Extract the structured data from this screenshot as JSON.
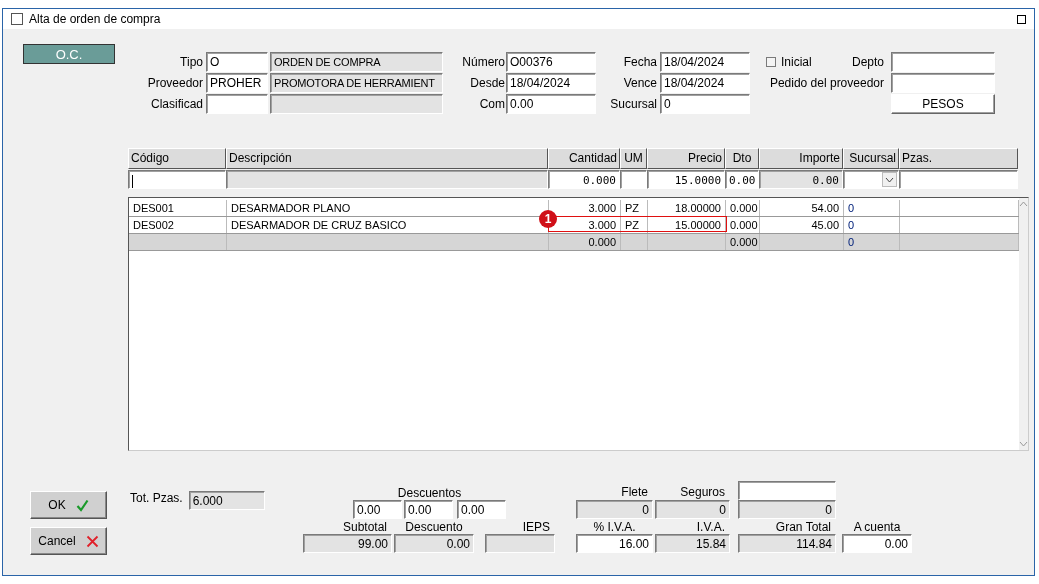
{
  "window": {
    "title": "Alta de orden de compra"
  },
  "oc_button": "O.C.",
  "header_rows": [
    {
      "label": "Tipo",
      "code": "O",
      "name": "ORDEN DE COMPRA",
      "mid_label": "Número",
      "mid_value": "O00376",
      "right_label": "Fecha",
      "right_value": "18/04/2024"
    },
    {
      "label": "Proveedor",
      "code": "PROHER",
      "name": "PROMOTORA DE HERRAMIENT",
      "mid_label": "Desde",
      "mid_value": "18/04/2024",
      "right_label": "Vence",
      "right_value": "18/04/2024"
    },
    {
      "label": "Clasificad",
      "mid_label": "Com",
      "mid_value": "0.00",
      "right_label": "Sucursal",
      "right_value": "0"
    }
  ],
  "inicial": {
    "label": "Inicial",
    "checked": false
  },
  "depto_label": "Depto",
  "pedido_label": "Pedido del proveedor",
  "currency_button": "PESOS",
  "table": {
    "columns": [
      "Código",
      "Descripción",
      "Cantidad",
      "UM",
      "Precio",
      "Dto",
      "Importe",
      "Sucursal",
      "Pzas."
    ],
    "edit_row": [
      {
        "kind": "text"
      },
      {
        "kind": "readonly"
      },
      {
        "kind": "text",
        "value": "0.000"
      },
      {
        "kind": "text"
      },
      {
        "kind": "text",
        "value": "15.0000"
      },
      {
        "kind": "text",
        "value": "0.00"
      },
      {
        "kind": "readonly",
        "value": "0.00"
      },
      {
        "kind": "combo"
      },
      {
        "kind": "text"
      }
    ],
    "rows": [
      {
        "kind": "item",
        "cells": [
          "DES001",
          "DESARMADOR PLANO",
          "3.000",
          "PZ",
          "18.00000",
          "0.000",
          "54.00",
          "0",
          null
        ]
      },
      {
        "kind": "item",
        "badge": "1",
        "cells": [
          "DES002",
          "DESARMADOR DE CRUZ BASICO",
          "3.000",
          "PZ",
          "15.00000",
          "0.000",
          "45.00",
          "0",
          null
        ]
      },
      {
        "kind": "total",
        "cells": [
          null,
          null,
          "0.000",
          null,
          null,
          "0.000",
          null,
          "0",
          null
        ]
      }
    ]
  },
  "buttons": [
    {
      "label": "OK",
      "kind": "ok"
    },
    {
      "label": "Cancel",
      "kind": "cancel"
    }
  ],
  "tot_pzas": {
    "label": "Tot. Pzas.",
    "value": "6.000"
  },
  "descuentos": {
    "label": "Descuentos",
    "values": [
      "0.00",
      "0.00",
      "0.00"
    ]
  },
  "charges": [
    {
      "label": "Flete",
      "value": "0"
    },
    {
      "label": "Seguros",
      "value": "0"
    },
    {
      "kind": "extra",
      "value": "0"
    }
  ],
  "totals": [
    {
      "label": "Subtotal",
      "value": "99.00",
      "kind": "readonly"
    },
    {
      "label": "Descuento",
      "value": "0.00",
      "kind": "readonly"
    },
    {
      "label": "IEPS",
      "kind": "readonly"
    },
    {
      "label": "% I.V.A.",
      "value": "16.00",
      "kind": "input"
    },
    {
      "label": "I.V.A.",
      "value": "15.84",
      "kind": "readonly"
    },
    {
      "label": "Gran Total",
      "value": "114.84",
      "kind": "readonly"
    },
    {
      "label": "A cuenta",
      "value": "0.00",
      "kind": "input"
    }
  ]
}
